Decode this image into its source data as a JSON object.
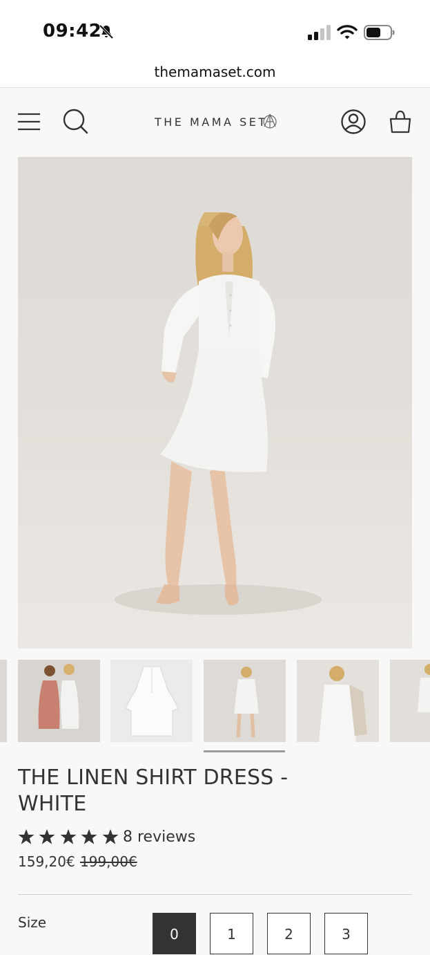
{
  "status_bar": {
    "time": "09:42",
    "icons": [
      "bell-slash-icon",
      "cellular-signal-icon",
      "wifi-icon",
      "battery-icon"
    ]
  },
  "browser": {
    "url": "themamaset.com"
  },
  "header": {
    "logo_text": "THE MAMA SET",
    "icons": [
      "menu-icon",
      "search-icon",
      "account-icon",
      "bag-icon"
    ]
  },
  "product": {
    "title": "THE LINEN SHIRT DRESS - WHITE",
    "rating": 5,
    "reviews_label": "8 reviews",
    "price": "159,20€",
    "compare_at_price": "199,00€",
    "gallery_selected_index": 2,
    "size": {
      "label": "Size",
      "options": [
        "0",
        "1",
        "2",
        "3"
      ],
      "selected": "0"
    }
  },
  "colors": {
    "text": "#2b2b2b",
    "background": "#f8f8f8",
    "accent": "#333333"
  }
}
